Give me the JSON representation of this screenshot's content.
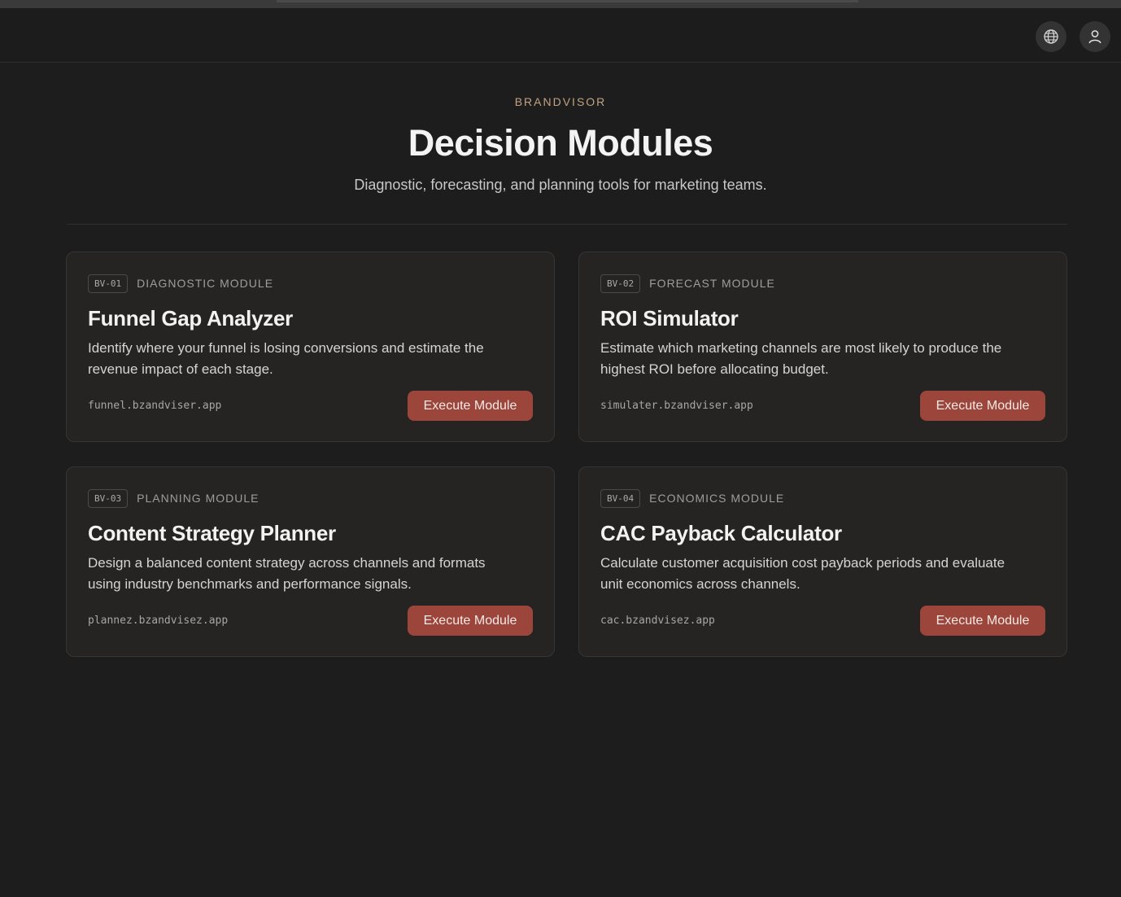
{
  "header": {
    "icons": [
      "globe-icon",
      "user-icon"
    ]
  },
  "hero": {
    "eyebrow": "BRANDVISOR",
    "title": "Decision Modules",
    "subtitle": "Diagnostic, forecasting, and planning tools for marketing teams."
  },
  "colors": {
    "background": "#1d1d1d",
    "card": "#252423",
    "accent_button": "#9c453b",
    "eyebrow": "#c1a383"
  },
  "modules": [
    {
      "code": "BV-01",
      "kind": "DIAGNOSTIC MODULE",
      "name": "Funnel Gap Analyzer",
      "description": "Identify where your funnel is losing conversions and estimate the revenue impact of each stage.",
      "url": "funnel.bzandviser.app",
      "action": "Execute Module"
    },
    {
      "code": "BV-02",
      "kind": "FORECAST MODULE",
      "name": "ROI Simulator",
      "description": "Estimate which marketing channels are most likely to produce the highest ROI before allocating budget.",
      "url": "simulater.bzandviser.app",
      "action": "Execute Module"
    },
    {
      "code": "BV-03",
      "kind": "PLANNING MODULE",
      "name": "Content Strategy Planner",
      "description": "Design a balanced content strategy across channels and formats using industry benchmarks and performance signals.",
      "url": "plannez.bzandvisez.app",
      "action": "Execute Module"
    },
    {
      "code": "BV-04",
      "kind": "ECONOMICS MODULE",
      "name": "CAC Payback Calculator",
      "description": "Calculate customer acquisition cost payback periods and evaluate unit economics across channels.",
      "url": "cac.bzandvisez.app",
      "action": "Execute Module"
    }
  ]
}
